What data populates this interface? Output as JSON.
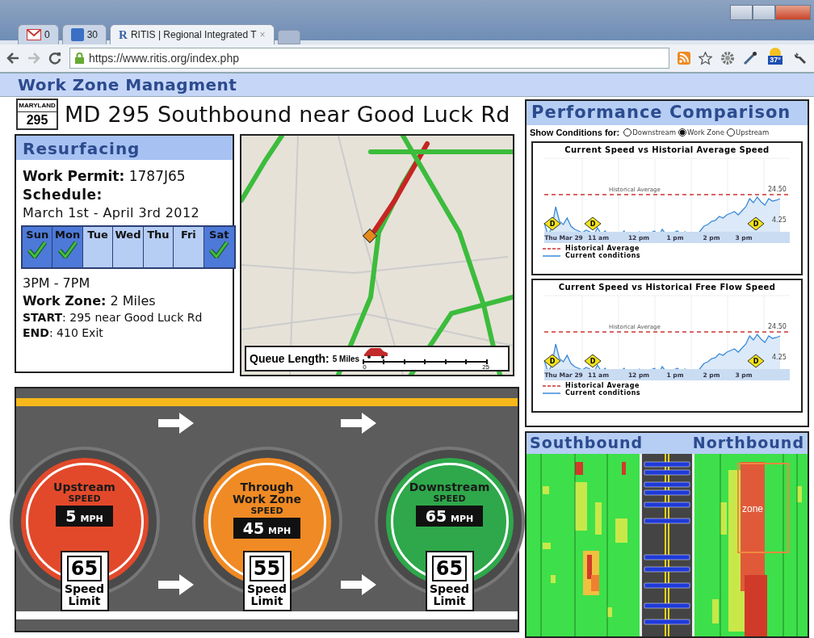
{
  "browser": {
    "tabs": [
      {
        "kind": "mail",
        "label": "0",
        "selected": false
      },
      {
        "kind": "calendar",
        "label": "30",
        "selected": false
      },
      {
        "kind": "page",
        "logo": "R",
        "label": "RITIS | Regional Integrated T",
        "close": "×",
        "selected": true
      }
    ],
    "url": "https://www.ritis.org/index.php",
    "weather": "37°"
  },
  "header": {
    "title": "Work Zone Managment"
  },
  "route": {
    "shield_state": "MARYLAND",
    "shield_number": "295",
    "title": "MD 295 Southbound near Good Luck Rd"
  },
  "project": {
    "title": "Resurfacing",
    "permit": "**Work Permit:**  1787J65",
    "schedule_label": "Schedule:",
    "dates": "March 1st - April 3rd 2012",
    "days": [
      {
        "label": "Sun",
        "checked": true
      },
      {
        "label": "Mon",
        "checked": true
      },
      {
        "label": "Tue",
        "checked": false
      },
      {
        "label": "Wed",
        "checked": false
      },
      {
        "label": "Thu",
        "checked": false
      },
      {
        "label": "Fri",
        "checked": false
      },
      {
        "label": "Sat",
        "checked": true
      }
    ],
    "hours": "3PM - 7PM",
    "zone": "**Work Zone:**  2 Miles",
    "start": "**START**: 295 near Good Luck Rd",
    "end": "**END**: 410 Exit"
  },
  "map": {
    "queue_label": "Queue Length:",
    "queue_value": "5 Miles",
    "scale_min": "0",
    "scale_max": "25"
  },
  "performance": {
    "title": "Performance Comparison",
    "filter_label": "Show Conditions for:",
    "options": [
      {
        "label": "Downstream",
        "selected": false
      },
      {
        "label": "Work Zone",
        "selected": true
      },
      {
        "label": "Upstream",
        "selected": false
      }
    ],
    "charts": [
      {
        "title": "Current Speed vs Historial Average Speed",
        "reference_label": "Historical Average",
        "y_labels": [
          "24.50",
          "4.25"
        ],
        "x_labels": [
          "Thu Mar 29",
          "11 am",
          "12 pm",
          "1 pm",
          "2 pm",
          "3 pm"
        ],
        "markers": [
          "D",
          "D",
          "D"
        ],
        "legend": [
          {
            "kind": "dashed",
            "label": "Historical Average"
          },
          {
            "kind": "solid",
            "label": "Current conditions"
          }
        ]
      },
      {
        "title": "Current Speed vs Historical Free Flow Speed",
        "reference_label": "Historical Average",
        "y_labels": [
          "24.50",
          "4.25"
        ],
        "x_labels": [
          "Thu Mar 29",
          "11 am",
          "12 pm",
          "1 pm",
          "2 pm",
          "3 pm"
        ],
        "markers": [
          "D",
          "D",
          "D"
        ],
        "legend": [
          {
            "kind": "dashed",
            "label": "Historical Average"
          },
          {
            "kind": "solid",
            "label": "Current conditions"
          }
        ]
      }
    ]
  },
  "signs": [
    {
      "title": "Upstream",
      "speed_label": "SPEED",
      "speed": "5",
      "unit": "MPH",
      "limit": "65",
      "limit_label": "Speed Limit",
      "color": "#e2492b"
    },
    {
      "title": "Through Work Zone",
      "speed_label": "SPEED",
      "speed": "45",
      "unit": "MPH",
      "limit": "55",
      "limit_label": "Speed Limit",
      "color": "#f08a24"
    },
    {
      "title": "Downstream",
      "speed_label": "SPEED",
      "speed": "65",
      "unit": "MPH",
      "limit": "65",
      "limit_label": "Speed Limit",
      "color": "#2ea84a"
    }
  ],
  "traffic": {
    "left_title": "Southbound",
    "right_title": "Northbound",
    "zone_label": "zone"
  }
}
